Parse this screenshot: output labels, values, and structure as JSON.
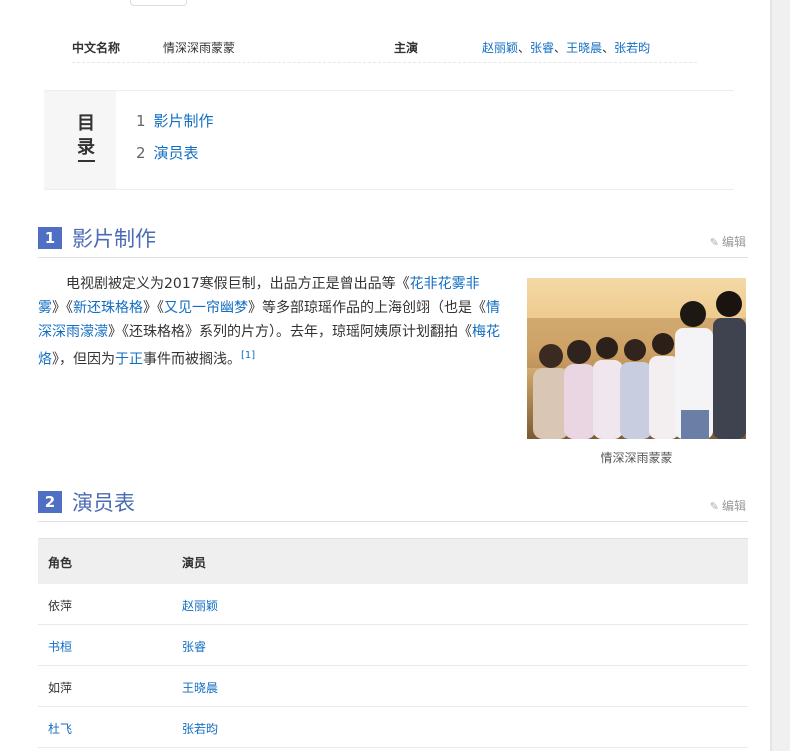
{
  "basic_info": {
    "chinese_name_label": "中文名称",
    "chinese_name_value": "情深深雨蒙蒙",
    "starring_label": "主演",
    "starring": [
      {
        "name": "赵丽颖",
        "sep": "、"
      },
      {
        "name": "张睿",
        "sep": "、"
      },
      {
        "name": "王晓晨",
        "sep": "、"
      },
      {
        "name": "张若昀",
        "sep": ""
      }
    ]
  },
  "catalog": {
    "title_1": "目",
    "title_2": "录",
    "items": [
      {
        "num": "1",
        "label": "影片制作"
      },
      {
        "num": "2",
        "label": "演员表"
      }
    ]
  },
  "section1": {
    "num": "1",
    "title": "影片制作",
    "edit": "编辑",
    "p1": "电视剧被定义为2017寒假巨制，出品方正是曾出品等《",
    "l1": "花非花雾非雾",
    "p2": "》《",
    "l2": "新还珠格格",
    "p3": "》《",
    "l3": "又见一帘幽梦",
    "p4": "》等多部琼瑶作品的上海创翊（也是《",
    "l4": "情深深雨濛濛",
    "p5": "》《还珠格格》系列的片方）。去年，琼瑶阿姨原计划翻拍《",
    "l5": "梅花烙",
    "p6": "》，但因为",
    "l6": "于正",
    "p7": "事件而被搁浅。",
    "ref": "[1]",
    "caption": "情深深雨蒙蒙"
  },
  "section2": {
    "num": "2",
    "title": "演员表",
    "edit": "编辑",
    "col_role": "角色",
    "col_actor": "演员",
    "rows": [
      {
        "role": "依萍",
        "actor": "赵丽颖",
        "role_link": false
      },
      {
        "role": "书桓",
        "actor": "张睿",
        "role_link": true
      },
      {
        "role": "如萍",
        "actor": "王晓晨",
        "role_link": false
      },
      {
        "role": "杜飞",
        "actor": "张若昀",
        "role_link": true
      }
    ]
  },
  "colors": {
    "link": "#136ec2",
    "section_num_bg": "#4f6fc4",
    "section_title": "#4b6bb5"
  }
}
